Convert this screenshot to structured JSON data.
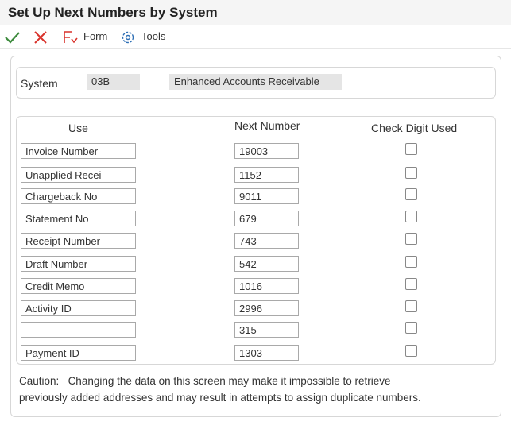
{
  "window": {
    "title": "Set Up Next Numbers by System"
  },
  "toolbar": {
    "ok_icon": "checkmark-icon",
    "cancel_icon": "x-icon",
    "form_label_u": "F",
    "form_label_rest": "orm",
    "tools_label_u": "T",
    "tools_label_rest": "ools",
    "colors": {
      "ok": "#3c8a3c",
      "cancel": "#d9322b",
      "form_icon": "#d9322b",
      "tools_icon": "#2e6fb5"
    }
  },
  "system": {
    "label": "System",
    "code": "03B",
    "description": "Enhanced Accounts Receivable"
  },
  "grid": {
    "headers": {
      "use": "Use",
      "next_number": "Next Number",
      "check_digit": "Check Digit Used"
    },
    "rows": [
      {
        "use": "Invoice Number",
        "next": "19003",
        "checked": false
      },
      {
        "use": "Unapplied Recei",
        "next": "1152",
        "checked": false
      },
      {
        "use": "Chargeback No",
        "next": "9011",
        "checked": false
      },
      {
        "use": "Statement No",
        "next": "679",
        "checked": false
      },
      {
        "use": "Receipt Number",
        "next": "743",
        "checked": false
      },
      {
        "use": "Draft Number",
        "next": "542",
        "checked": false
      },
      {
        "use": "Credit Memo",
        "next": "1016",
        "checked": false
      },
      {
        "use": "Activity ID",
        "next": "2996",
        "checked": false
      },
      {
        "use": "",
        "next": "315",
        "checked": false
      },
      {
        "use": "Payment ID",
        "next": "1303",
        "checked": false
      }
    ]
  },
  "caution": {
    "label": "Caution:",
    "line1": "Changing the data on this screen may make it impossible to retrieve",
    "line2": "previously added addresses and may result in attempts to assign duplicate numbers."
  }
}
